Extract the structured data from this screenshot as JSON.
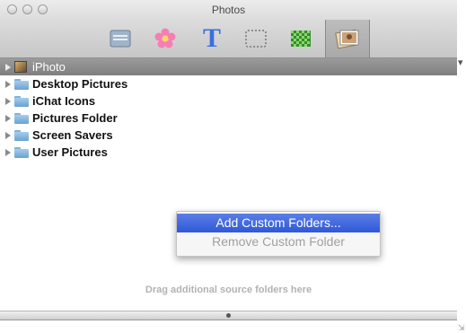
{
  "window": {
    "title": "Photos"
  },
  "toolbar": {
    "items": [
      {
        "icon": "screen-icon"
      },
      {
        "icon": "flower-icon"
      },
      {
        "icon": "text-icon"
      },
      {
        "icon": "selection-icon"
      },
      {
        "icon": "pattern-icon"
      },
      {
        "icon": "photos-icon",
        "selected": true
      }
    ],
    "text_glyph": "T"
  },
  "sources": [
    {
      "label": "iPhoto",
      "selected": true
    },
    {
      "label": "Desktop Pictures"
    },
    {
      "label": "iChat Icons"
    },
    {
      "label": "Pictures Folder"
    },
    {
      "label": "Screen Savers"
    },
    {
      "label": "User Pictures"
    }
  ],
  "context_menu": {
    "items": [
      {
        "label": "Add Custom Folders...",
        "state": "highlighted"
      },
      {
        "label": "Remove Custom Folder",
        "state": "disabled"
      }
    ]
  },
  "hint": "Drag additional source folders here",
  "colors": {
    "menu_highlight": "#3c64dc",
    "selection": "#8c8c8c"
  }
}
